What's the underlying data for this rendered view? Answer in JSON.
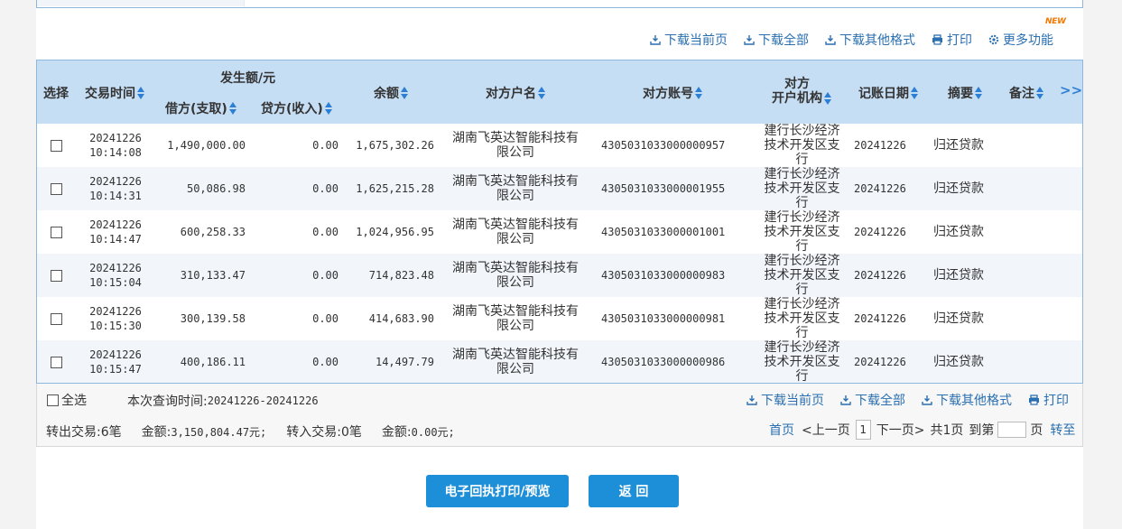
{
  "toolbar_top": {
    "items": [
      "下载当前页",
      "下载全部",
      "下载其他格式",
      "打印",
      "更多功能"
    ],
    "new_badge": "NEW"
  },
  "table": {
    "headers": {
      "select": "选择",
      "time": "交易时间",
      "amount_group": "发生额/元",
      "debit": "借方(支取)",
      "credit": "贷方(收入)",
      "balance": "余额",
      "counterparty_name": "对方户名",
      "counterparty_account": "对方账号",
      "counterparty_bank_line1": "对方",
      "counterparty_bank_line2": "开户机构",
      "post_date": "记账日期",
      "summary": "摘要",
      "remark": "备注",
      "more": ">>"
    },
    "rows": [
      {
        "date": "20241226",
        "time": "10:14:08",
        "debit": "1,490,000.00",
        "credit": "0.00",
        "balance": "1,675,302.26",
        "name": "湖南飞英达智能科技有限公司",
        "account": "4305031033000000957",
        "bank": "建行长沙经济技术开发区支行",
        "post_date": "20241226",
        "summary": "归还贷款",
        "remark": ""
      },
      {
        "date": "20241226",
        "time": "10:14:31",
        "debit": "50,086.98",
        "credit": "0.00",
        "balance": "1,625,215.28",
        "name": "湖南飞英达智能科技有限公司",
        "account": "4305031033000001955",
        "bank": "建行长沙经济技术开发区支行",
        "post_date": "20241226",
        "summary": "归还贷款",
        "remark": ""
      },
      {
        "date": "20241226",
        "time": "10:14:47",
        "debit": "600,258.33",
        "credit": "0.00",
        "balance": "1,024,956.95",
        "name": "湖南飞英达智能科技有限公司",
        "account": "4305031033000001001",
        "bank": "建行长沙经济技术开发区支行",
        "post_date": "20241226",
        "summary": "归还贷款",
        "remark": ""
      },
      {
        "date": "20241226",
        "time": "10:15:04",
        "debit": "310,133.47",
        "credit": "0.00",
        "balance": "714,823.48",
        "name": "湖南飞英达智能科技有限公司",
        "account": "4305031033000000983",
        "bank": "建行长沙经济技术开发区支行",
        "post_date": "20241226",
        "summary": "归还贷款",
        "remark": ""
      },
      {
        "date": "20241226",
        "time": "10:15:30",
        "debit": "300,139.58",
        "credit": "0.00",
        "balance": "414,683.90",
        "name": "湖南飞英达智能科技有限公司",
        "account": "4305031033000000981",
        "bank": "建行长沙经济技术开发区支行",
        "post_date": "20241226",
        "summary": "归还贷款",
        "remark": ""
      },
      {
        "date": "20241226",
        "time": "10:15:47",
        "debit": "400,186.11",
        "credit": "0.00",
        "balance": "14,497.79",
        "name": "湖南飞英达智能科技有限公司",
        "account": "4305031033000000986",
        "bank": "建行长沙经济技术开发区支行",
        "post_date": "20241226",
        "summary": "归还贷款",
        "remark": ""
      }
    ]
  },
  "footer": {
    "select_all": "全选",
    "query_time_label": "本次查询时间:",
    "query_time_value": "20241226-20241226",
    "actions": [
      "下载当前页",
      "下载全部",
      "下载其他格式",
      "打印"
    ],
    "out_label": "转出交易:",
    "out_count": "6笔",
    "out_amount_label": "金额:",
    "out_amount": "3,150,804.47元;",
    "in_label": "转入交易:",
    "in_count": "0笔",
    "in_amount_label": "金额:",
    "in_amount": "0.00元;",
    "pager": {
      "first": "首页",
      "prev": "<上一页",
      "current": "1",
      "next": "下一页>",
      "total": "共1页",
      "goto_prefix": "到第",
      "goto_suffix": "页",
      "go": "转至"
    }
  },
  "buttons": {
    "receipt": "电子回执打印/预览",
    "back": "返 回"
  },
  "colors": {
    "accent": "#1d8fd8",
    "link": "#2a6fb0",
    "header_bg": "#c6def4",
    "badge": "#f07800"
  }
}
